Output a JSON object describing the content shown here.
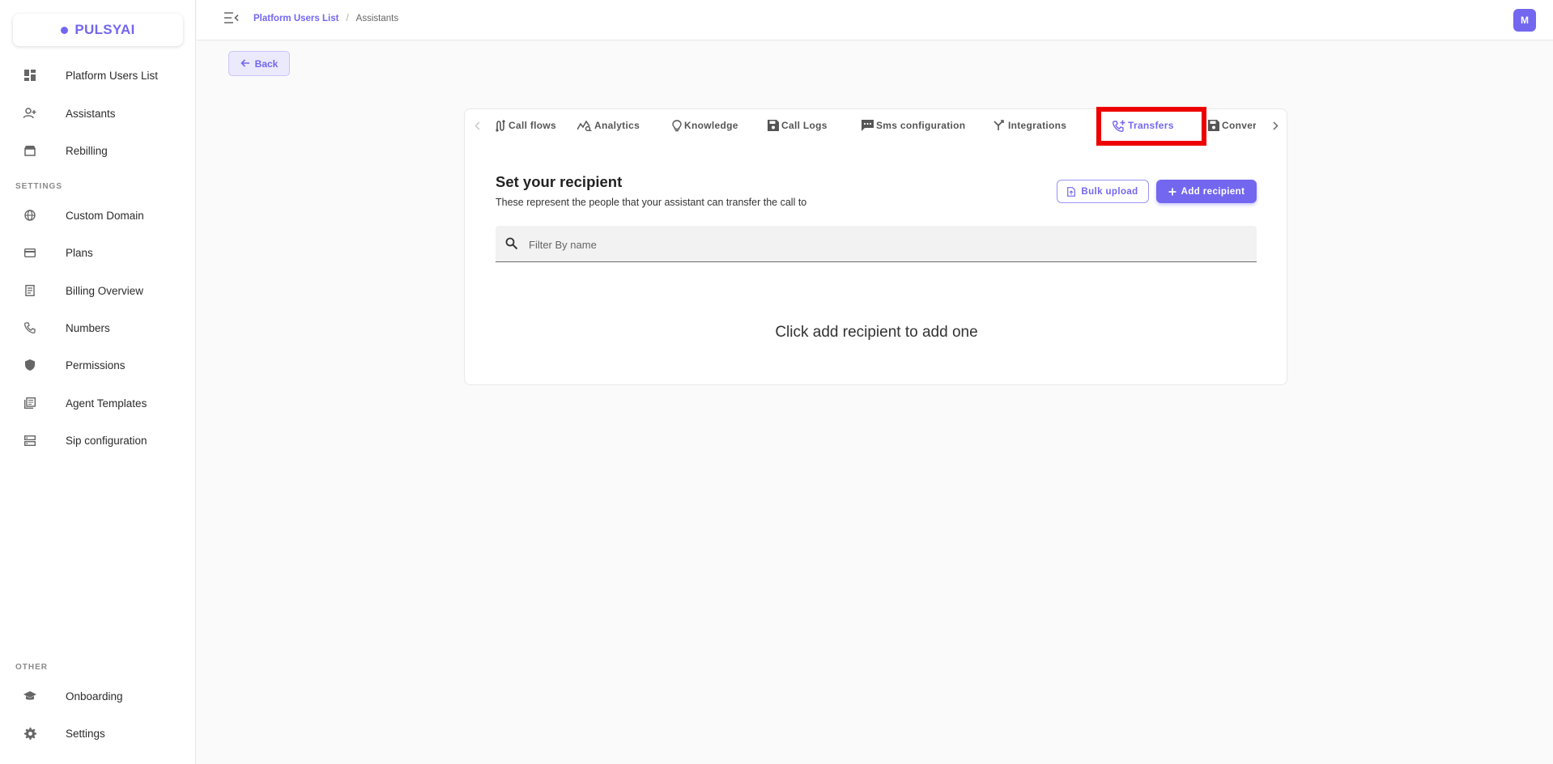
{
  "brand": {
    "name": "PULSYAI"
  },
  "sidebar": {
    "main_items": [
      {
        "label": "Platform Users List",
        "icon": "dashboard-icon"
      },
      {
        "label": "Assistants",
        "icon": "person-add-icon"
      },
      {
        "label": "Rebilling",
        "icon": "store-icon"
      }
    ],
    "settings_section": "SETTINGS",
    "settings_items": [
      {
        "label": "Custom Domain",
        "icon": "globe-icon"
      },
      {
        "label": "Plans",
        "icon": "credit-card-icon"
      },
      {
        "label": "Billing Overview",
        "icon": "receipt-icon"
      },
      {
        "label": "Numbers",
        "icon": "phone-icon"
      },
      {
        "label": "Permissions",
        "icon": "shield-icon"
      },
      {
        "label": "Agent Templates",
        "icon": "library-icon"
      },
      {
        "label": "Sip configuration",
        "icon": "server-icon"
      }
    ],
    "other_section": "OTHER",
    "other_items": [
      {
        "label": "Onboarding",
        "icon": "school-icon"
      },
      {
        "label": "Settings",
        "icon": "gear-icon"
      }
    ]
  },
  "header": {
    "breadcrumb_link": "Platform Users List",
    "breadcrumb_separator": "/",
    "breadcrumb_current": "Assistants",
    "avatar_initial": "M"
  },
  "back_button": {
    "label": "Back"
  },
  "tabs": [
    {
      "label": "Call flows",
      "icon": "route-icon"
    },
    {
      "label": "Analytics",
      "icon": "analytics-icon"
    },
    {
      "label": "Knowledge",
      "icon": "lightbulb-icon"
    },
    {
      "label": "Call Logs",
      "icon": "save-icon"
    },
    {
      "label": "Sms configuration",
      "icon": "sms-icon"
    },
    {
      "label": "Integrations",
      "icon": "merge-icon"
    },
    {
      "label": "Transfers",
      "icon": "phone-forward-icon",
      "active": true
    },
    {
      "label": "Conversations",
      "icon": "save-icon"
    }
  ],
  "recipients": {
    "title": "Set your recipient",
    "subtitle": "These represent the people that your assistant can transfer the call to",
    "bulk_upload_label": "Bulk upload",
    "add_recipient_label": "Add recipient",
    "filter_placeholder": "Filter By name",
    "filter_value": "",
    "empty_message": "Click add recipient to add one"
  },
  "colors": {
    "accent": "#7367f0",
    "highlight": "#ee0000"
  }
}
